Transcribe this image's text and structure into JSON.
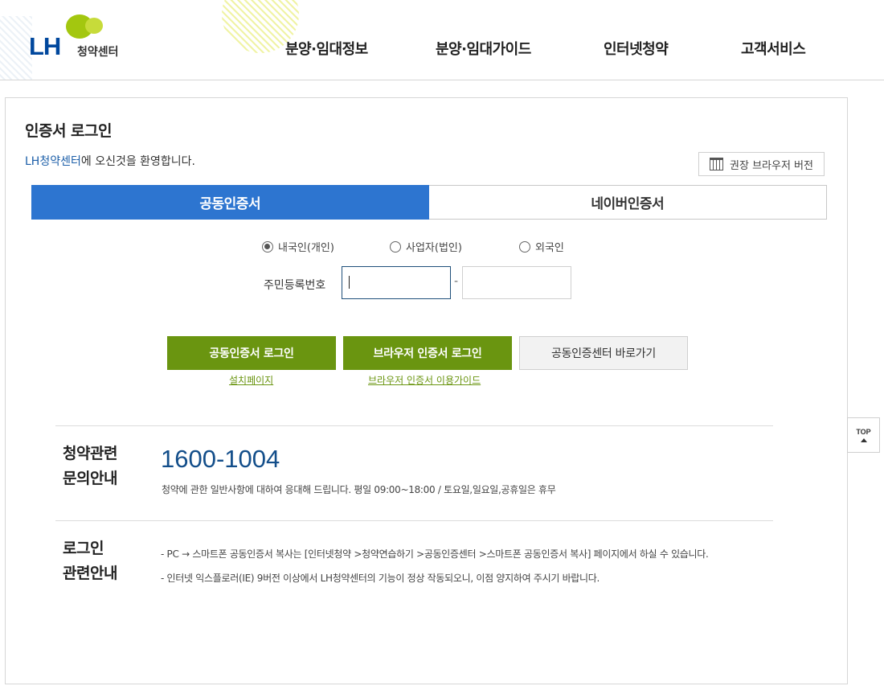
{
  "header": {
    "logo_mark": "LH",
    "logo_text": "청약센터",
    "nav": [
      "분양·임대정보",
      "분양·임대가이드",
      "인터넷청약",
      "고객서비스"
    ]
  },
  "login": {
    "title": "인증서 로그인",
    "welcome_highlight": "LH청약센터",
    "welcome_rest": "에 오신것을 환영합니다.",
    "browser_version_label": "권장 브라우저 버전",
    "tabs": [
      "공동인증서",
      "네이버인증서"
    ],
    "active_tab": "공동인증서",
    "radios": [
      {
        "label": "내국인(개인)",
        "checked": true
      },
      {
        "label": "사업자(법인)",
        "checked": false
      },
      {
        "label": "외국인",
        "checked": false
      }
    ],
    "ssn_label": "주민등록번호",
    "ssn_dash": "-",
    "ssn_front_value": "",
    "ssn_back_value": "",
    "buttons": {
      "cert_login": "공동인증서 로그인",
      "browser_cert_login": "브라우저 인증서 로그인",
      "cert_center": "공동인증센터 바로가기"
    },
    "links": {
      "install_page": "설치페이지",
      "browser_cert_guide": "브라우저 인증서 이용가이드"
    }
  },
  "inquiry": {
    "title_line1": "청약관련",
    "title_line2": "문의안내",
    "phone": "1600-1004",
    "desc": "청약에 관한 일반사항에 대하여 응대해 드립니다. 평일 09:00~18:00  /  토요일,일요일,공휴일은 휴무"
  },
  "login_info": {
    "title_line1": "로그인",
    "title_line2": "관련안내",
    "line1": "- PC → 스마트폰 공동인증서 복사는 [인터넷청약 >청약연습하기 >공동인증센터 >스마트폰 공동인증서 복사] 페이지에서 하실 수 있습니다.",
    "line2": "- 인터넷 익스플로러(IE) 9버전 이상에서 LH청약센터의 기능이 정상 작동되오니, 이점 양지하여 주시기 바랍니다."
  },
  "top_button": "TOP",
  "colors": {
    "tab_active": "#2d75d0",
    "button_green": "#6a9510",
    "phone_blue": "#134e8a",
    "brand_blue": "#00479d",
    "brand_green": "#a3c70f"
  }
}
